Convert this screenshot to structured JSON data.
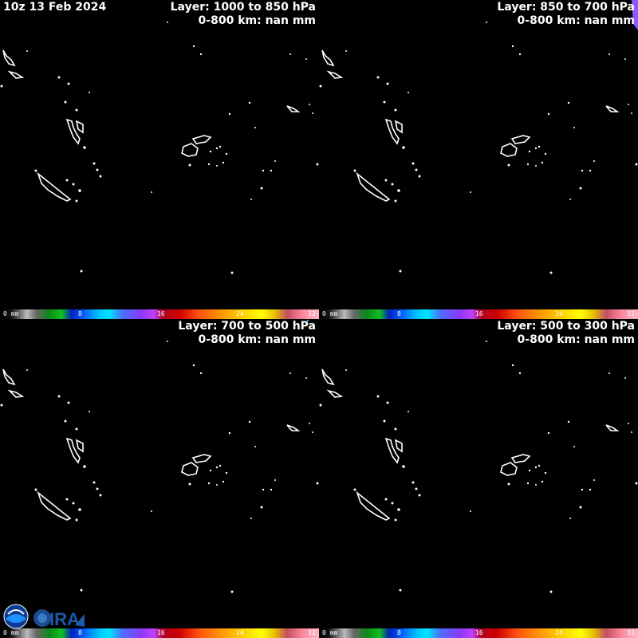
{
  "datetime": "10z 13 Feb 2024",
  "panels": [
    {
      "layer": "Layer: 1000 to 850 hPa",
      "value": "0-800 km: nan mm"
    },
    {
      "layer": "Layer: 850 to 700 hPa",
      "value": "0-800 km: nan mm"
    },
    {
      "layer": "Layer: 700 to 500 hPa",
      "value": "0-800 km: nan mm"
    },
    {
      "layer": "Layer: 500 to 300 hPa",
      "value": "0-800 km: nan mm"
    }
  ],
  "colorbar": {
    "unit": "mm",
    "ticks": [
      "0",
      "8",
      "16",
      "24",
      "32"
    ]
  },
  "logos": [
    "noaa-logo",
    "cira-logo"
  ],
  "colors": {
    "background": "#000000",
    "coastline": "#ffffff",
    "text": "#ffffff"
  }
}
